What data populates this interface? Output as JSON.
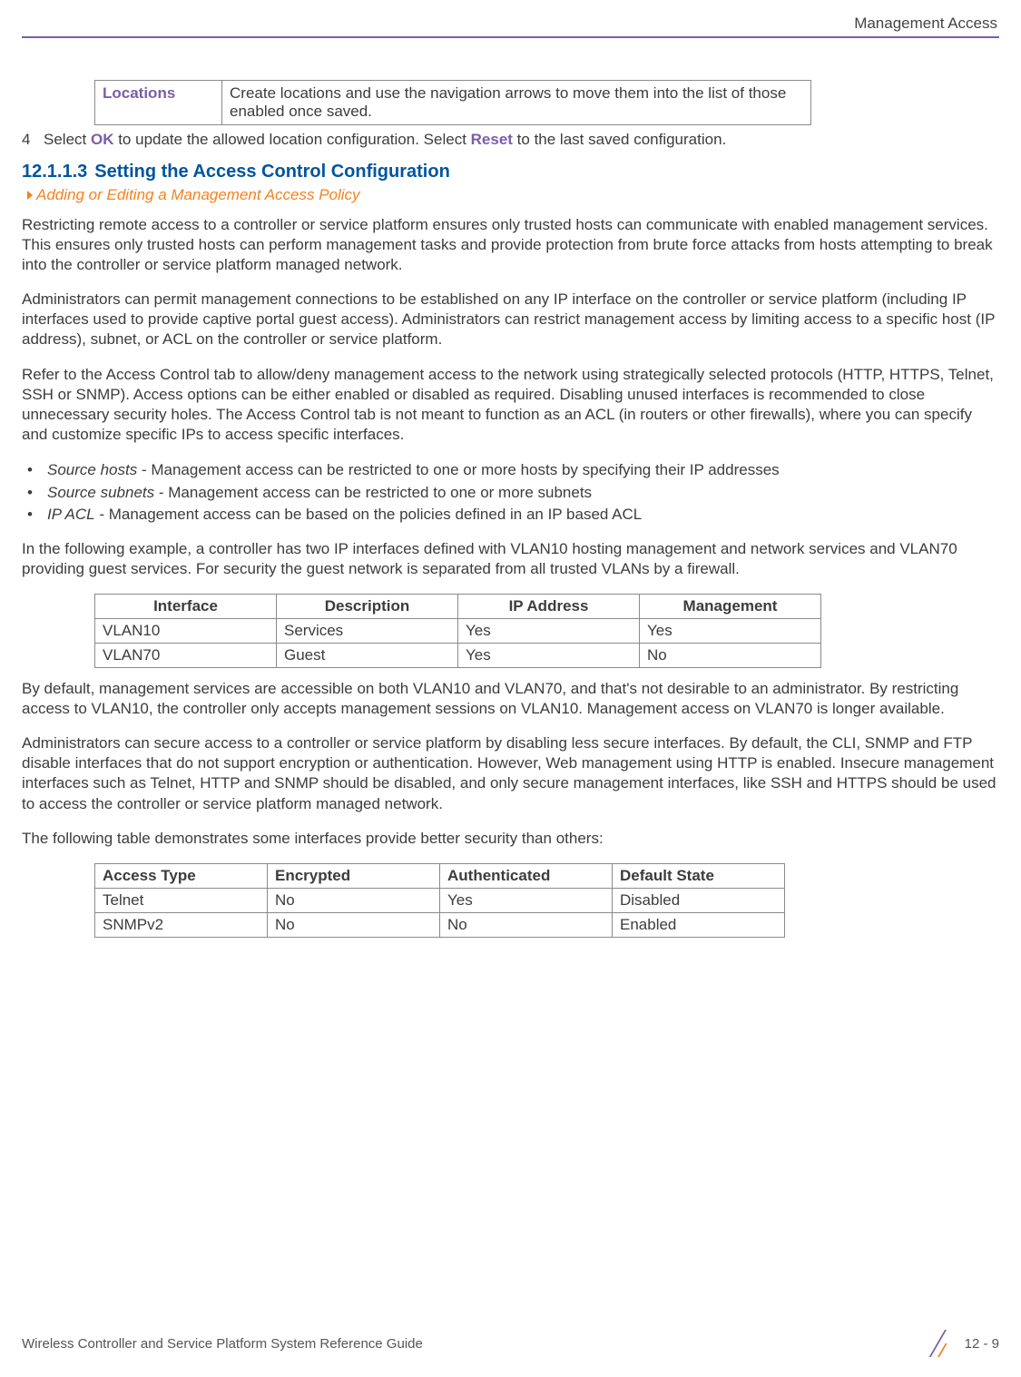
{
  "header": {
    "section": "Management Access"
  },
  "locTable": {
    "label": "Locations",
    "desc": "Create locations and use the navigation arrows to move them into the list of those enabled once saved."
  },
  "step4": {
    "num": "4",
    "pre": "Select ",
    "ok": "OK",
    "mid": " to update the allowed location configuration. Select ",
    "reset": "Reset",
    "post": " to the last saved configuration."
  },
  "heading": {
    "num": "12.1.1.3",
    "text": "Setting the Access Control Configuration"
  },
  "breadcrumb": "Adding or Editing a Management Access Policy",
  "para1": "Restricting remote access to a controller or service platform ensures only trusted hosts can communicate with enabled management services. This ensures only trusted hosts can perform management tasks and provide protection from brute force attacks from hosts attempting to break into the controller or service platform managed network.",
  "para2": "Administrators can permit management connections to be established on any IP interface on the controller or service platform (including IP interfaces used to provide captive portal guest access). Administrators can restrict management access by limiting access to a specific host (IP address), subnet, or ACL on the controller or service platform.",
  "para3": "Refer to the Access Control tab to allow/deny management access to the network using strategically selected protocols (HTTP, HTTPS, Telnet, SSH or SNMP). Access options can be either enabled or disabled as required. Disabling unused interfaces is recommended to close unnecessary security holes. The Access Control tab is not meant to function as an ACL (in routers or other firewalls), where you can specify and customize specific IPs to access specific interfaces.",
  "bullets": [
    {
      "term": "Source hosts",
      "text": " - Management access can be restricted to one or more hosts by specifying their IP addresses"
    },
    {
      "term": "Source subnets",
      "text": " - Management access can be restricted to one or more subnets"
    },
    {
      "term": "IP ACL",
      "text": " - Management access can be based on the policies defined in an IP based ACL"
    }
  ],
  "para4": "In the following example, a controller has two IP interfaces defined with VLAN10 hosting management and network services and VLAN70 providing guest services. For security the guest network is separated from all trusted VLANs by a firewall.",
  "table1": {
    "headers": [
      "Interface",
      "Description",
      "IP Address",
      "Management"
    ],
    "rows": [
      [
        "VLAN10",
        "Services",
        "Yes",
        "Yes"
      ],
      [
        "VLAN70",
        "Guest",
        "Yes",
        "No"
      ]
    ]
  },
  "para5": "By default, management services are accessible on both VLAN10 and VLAN70, and that's not desirable to an administrator. By restricting access to VLAN10, the controller only accepts management sessions on VLAN10. Management access on VLAN70 is longer available.",
  "para6": "Administrators can secure access to a controller or service platform by disabling less secure interfaces. By default, the CLI, SNMP and FTP disable interfaces that do not support encryption or authentication. However, Web management using HTTP is enabled. Insecure management interfaces such as Telnet, HTTP and SNMP should be disabled, and only secure management interfaces, like SSH and HTTPS should be used to access the controller or service platform managed network.",
  "para7": "The following table demonstrates some interfaces provide better security than others:",
  "table2": {
    "headers": [
      "Access Type",
      "Encrypted",
      "Authenticated",
      "Default State"
    ],
    "rows": [
      [
        "Telnet",
        "No",
        "Yes",
        "Disabled"
      ],
      [
        "SNMPv2",
        "No",
        "No",
        "Enabled"
      ]
    ]
  },
  "footer": {
    "left": "Wireless Controller and Service Platform System Reference Guide",
    "right": "12 - 9"
  }
}
